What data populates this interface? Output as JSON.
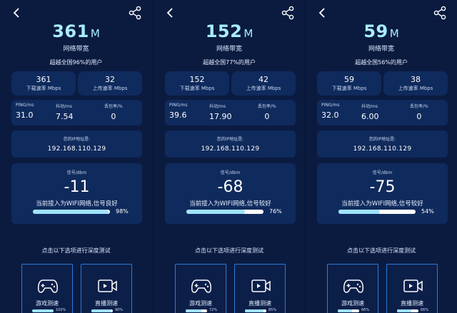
{
  "colors": {
    "background": "#0b1b40",
    "card": "#0f2a5c",
    "accent": "#a8ecff",
    "bar_fill": "#9fe3ff",
    "card_border": "#2b7bd9"
  },
  "icons": {
    "back": "chevron-left-icon",
    "share": "share-icon",
    "game": "gamepad-icon",
    "live": "video-icon"
  },
  "panels": [
    {
      "bandwidth": {
        "value": "361",
        "unit": "M",
        "label": "网络带宽"
      },
      "exceed_text": "超越全国96%的用户",
      "download": {
        "value": "361",
        "label": "下载速率 Mbps"
      },
      "upload": {
        "value": "32",
        "label": "上传速率 Mbps"
      },
      "ping": {
        "label": "PING/ms",
        "value": "31.0"
      },
      "jitter": {
        "label": "抖动/ms",
        "value": "7.54"
      },
      "loss": {
        "label": "丢包率/%",
        "value": "0"
      },
      "ip": {
        "label": "您的IP地址是:",
        "value": "192.168.110.129"
      },
      "signal": {
        "label": "信号/dbm",
        "value": "-11",
        "text": "当前接入为WIFI网络,信号良好",
        "percent_text": "98%",
        "percent": 98
      },
      "deep_test": "点击以下选项进行深度测试",
      "game": {
        "label": "游戏测速",
        "percent_text": "100%",
        "percent": 100
      },
      "live": {
        "label": "直播测速",
        "percent_text": "90%",
        "percent": 90
      }
    },
    {
      "bandwidth": {
        "value": "152",
        "unit": "M",
        "label": "网络带宽"
      },
      "exceed_text": "超越全国77%的用户",
      "download": {
        "value": "152",
        "label": "下载速率 Mbps"
      },
      "upload": {
        "value": "42",
        "label": "上传速率 Mbps"
      },
      "ping": {
        "label": "PING/ms",
        "value": "39.6"
      },
      "jitter": {
        "label": "抖动/ms",
        "value": "17.90"
      },
      "loss": {
        "label": "丢包率/%",
        "value": "0"
      },
      "ip": {
        "label": "您的IP地址是:",
        "value": "192.168.110.129"
      },
      "signal": {
        "label": "信号/dbm",
        "value": "-68",
        "text": "当前接入为WIFI网络,信号较好",
        "percent_text": "76%",
        "percent": 76
      },
      "deep_test": "点击以下选项进行深度测试",
      "game": {
        "label": "游戏测速",
        "percent_text": "72%",
        "percent": 72
      },
      "live": {
        "label": "直播测速",
        "percent_text": "85%",
        "percent": 85
      }
    },
    {
      "bandwidth": {
        "value": "59",
        "unit": "M",
        "label": "网络带宽"
      },
      "exceed_text": "超越全国56%的用户",
      "download": {
        "value": "59",
        "label": "下载速率 Mbps"
      },
      "upload": {
        "value": "38",
        "label": "上传速率 Mbps"
      },
      "ping": {
        "label": "PING/ms",
        "value": "32.0"
      },
      "jitter": {
        "label": "抖动/ms",
        "value": "6.00"
      },
      "loss": {
        "label": "丢包率/%",
        "value": "0"
      },
      "ip": {
        "label": "您的IP地址是:",
        "value": "192.168.110.129"
      },
      "signal": {
        "label": "信号/dbm",
        "value": "-75",
        "text": "当前接入为WIFI网络,信号较好",
        "percent_text": "54%",
        "percent": 54
      },
      "deep_test": "点击以下选项进行深度测试",
      "game": {
        "label": "游戏测速",
        "percent_text": "66%",
        "percent": 66
      },
      "live": {
        "label": "直播测速",
        "percent_text": "66%",
        "percent": 66
      }
    }
  ]
}
